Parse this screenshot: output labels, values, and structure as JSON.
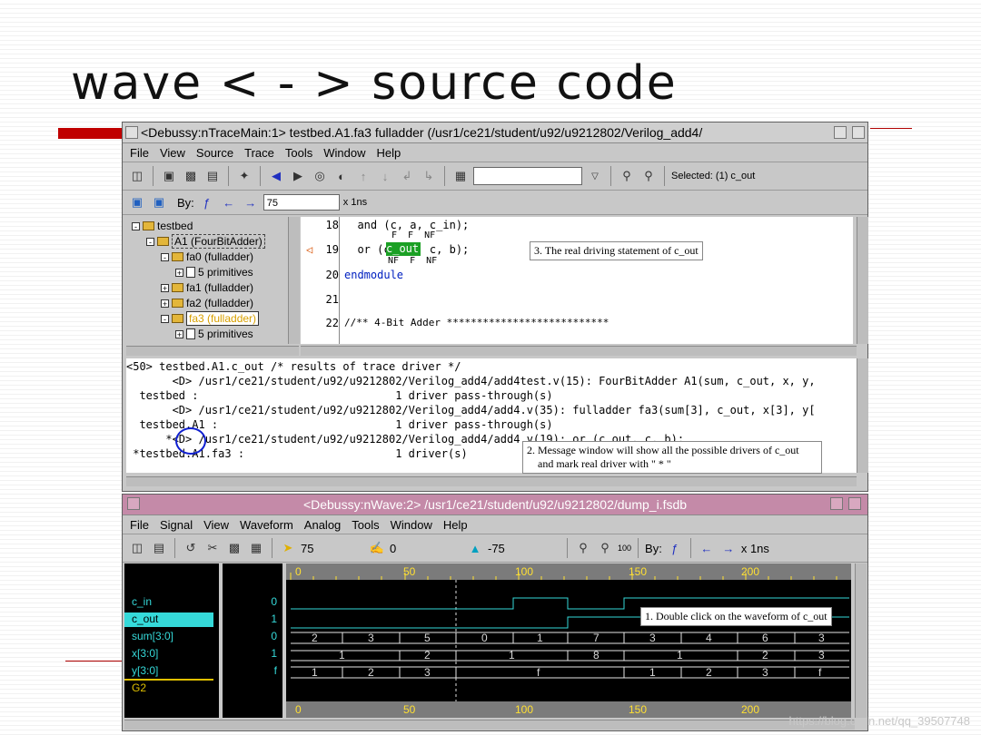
{
  "slide": {
    "title": "wave < - > source code"
  },
  "trace_window": {
    "title": "<Debussy:nTraceMain:1> testbed.A1.fa3 fulladder (/usr1/ce21/student/u92/u9212802/Verilog_add4/",
    "menu": [
      "File",
      "View",
      "Source",
      "Trace",
      "Tools",
      "Window",
      "Help"
    ],
    "selected_label": "Selected: (1) c_out",
    "by_label": "By:",
    "time_value": "75",
    "time_unit": "x 1ns",
    "hierarchy": [
      {
        "label": "testbed"
      },
      {
        "label": "A1 (FourBitAdder)"
      },
      {
        "label": "fa0 (fulladder)"
      },
      {
        "label": "5 primitives"
      },
      {
        "label": "fa1 (fulladder)"
      },
      {
        "label": "fa2 (fulladder)"
      },
      {
        "label": "fa3 (fulladder)"
      },
      {
        "label": "5 primitives"
      }
    ],
    "source_lines": [
      {
        "num": "18",
        "code": "  and (c, a, c_in);"
      },
      {
        "num": "19",
        "code": "  or (c_out, c, b);"
      },
      {
        "num": "20",
        "code": "endmodule"
      },
      {
        "num": "21",
        "code": ""
      },
      {
        "num": "22",
        "code": "//** 4-Bit Adder ***************************"
      }
    ],
    "annotations_18": "F  F  NF",
    "annotations_19": "NF  F  NF",
    "messages": [
      "<50> testbed.A1.c_out /* results of trace driver */",
      "       <D> /usr1/ce21/student/u92/u9212802/Verilog_add4/add4test.v(15): FourBitAdder A1(sum, c_out, x, y,",
      "  testbed :                              1 driver pass-through(s)",
      "       <D> /usr1/ce21/student/u92/u9212802/Verilog_add4/add4.v(35): fulladder fa3(sum[3], c_out, x[3], y[",
      "  testbed.A1 :                           1 driver pass-through(s)",
      "      *<D> /usr1/ce21/student/u92/u9212802/Verilog_add4/add4.v(19): or (c_out, c, b);",
      " *testbed.A1.fa3 :                       1 driver(s)"
    ],
    "note3": "3. The real driving statement of c_out",
    "note2": "2. Message window will show all the possible drivers of c_out\n    and mark real driver with \" * \""
  },
  "wave_window": {
    "title": "<Debussy:nWave:2> /usr1/ce21/student/u92/u9212802/dump_i.fsdb",
    "menu": [
      "File",
      "Signal",
      "View",
      "Waveform",
      "Analog",
      "Tools",
      "Window",
      "Help"
    ],
    "cursor_time": "75",
    "marker_time": "0",
    "delta_time": "-75",
    "zoom_label": "100",
    "by_label": "By:",
    "unit": "x 1ns",
    "signals": [
      {
        "name": "c_in",
        "value": "0"
      },
      {
        "name": "c_out",
        "value": "1"
      },
      {
        "name": "sum[3:0]",
        "value": "0"
      },
      {
        "name": "x[3:0]",
        "value": "1"
      },
      {
        "name": "y[3:0]",
        "value": "f"
      },
      {
        "name": "G2",
        "value": ""
      }
    ],
    "ruler_labels": [
      "0",
      "50",
      "100",
      "150",
      "200"
    ],
    "sum_values": [
      "2",
      "3",
      "5",
      "0",
      "1",
      "7",
      "3",
      "4",
      "6",
      "3"
    ],
    "x_values": [
      "1",
      "2",
      "1",
      "8",
      "1",
      "2",
      "3"
    ],
    "y_values": [
      "1",
      "2",
      "3",
      "f",
      "1",
      "2",
      "3",
      "f"
    ],
    "note1": "1. Double click on the waveform of c_out"
  },
  "watermark": "https://blog.csdn.net/qq_39507748",
  "colors": {
    "accent_red": "#c00000",
    "wave_title": "#c48aa8",
    "signal": "#35d9d9",
    "ruler_text": "#ffe033"
  }
}
